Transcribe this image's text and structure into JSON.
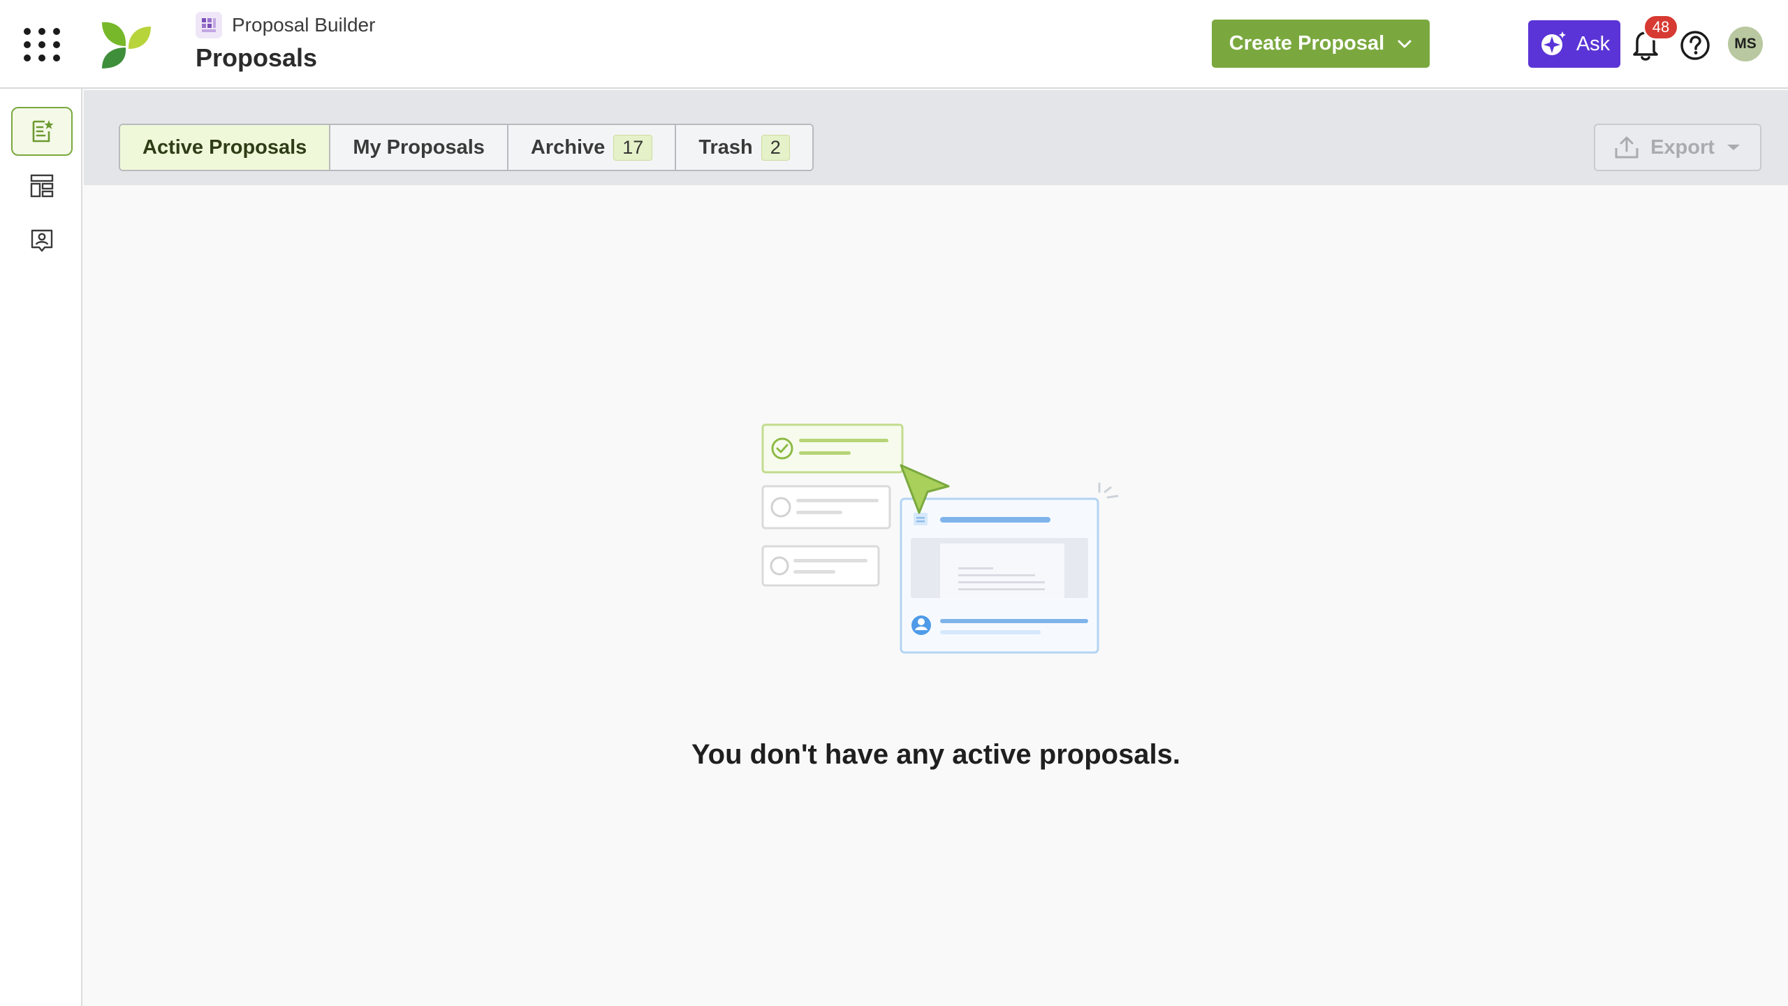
{
  "header": {
    "product_name": "Proposal Builder",
    "page_title": "Proposals",
    "create_label": "Create Proposal",
    "ask_label": "Ask",
    "notification_count": "48",
    "avatar_initials": "MS"
  },
  "tabs": [
    {
      "label": "Active Proposals",
      "count": null,
      "active": true
    },
    {
      "label": "My Proposals",
      "count": null,
      "active": false
    },
    {
      "label": "Archive",
      "count": "17",
      "active": false
    },
    {
      "label": "Trash",
      "count": "2",
      "active": false
    }
  ],
  "export_label": "Export",
  "empty_state": {
    "message": "You don't have any active proposals."
  },
  "rail": {
    "items": [
      {
        "icon": "proposal-star-icon",
        "active": true
      },
      {
        "icon": "layout-template-icon",
        "active": false
      },
      {
        "icon": "contact-card-icon",
        "active": false
      }
    ]
  },
  "colors": {
    "brand_green": "#7aa83e",
    "ask_purple": "#5a34d6",
    "badge_red": "#d63a32",
    "active_tab_bg": "#eff8d9"
  }
}
